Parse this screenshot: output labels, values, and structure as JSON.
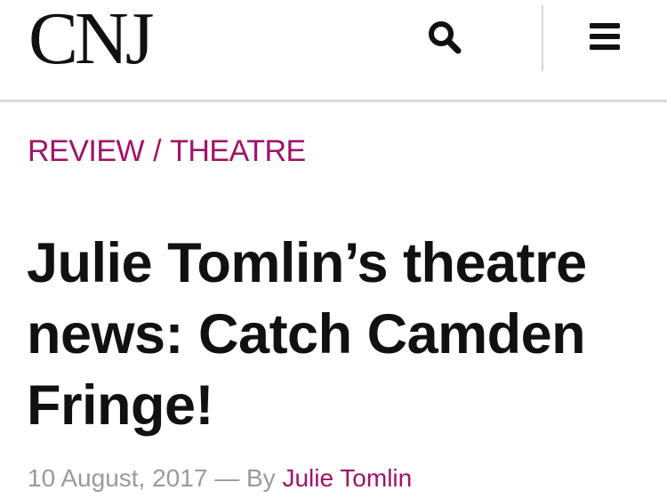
{
  "header": {
    "logo_text": "CNJ",
    "search_icon": "search-icon",
    "menu_icon": "hamburger-menu-icon"
  },
  "article": {
    "category_primary": "REVIEW",
    "category_separator": "/",
    "category_secondary": "THEATRE",
    "title": "Julie Tomlin’s theatre news: Catch Camden Fringe!",
    "date": "10 August, 2017",
    "dash": "—",
    "by_label": "By",
    "author": "Julie Tomlin"
  },
  "colors": {
    "accent": "#a0136a",
    "text": "#111111",
    "muted": "#9a9a9a",
    "divider": "#d9d9d9"
  }
}
